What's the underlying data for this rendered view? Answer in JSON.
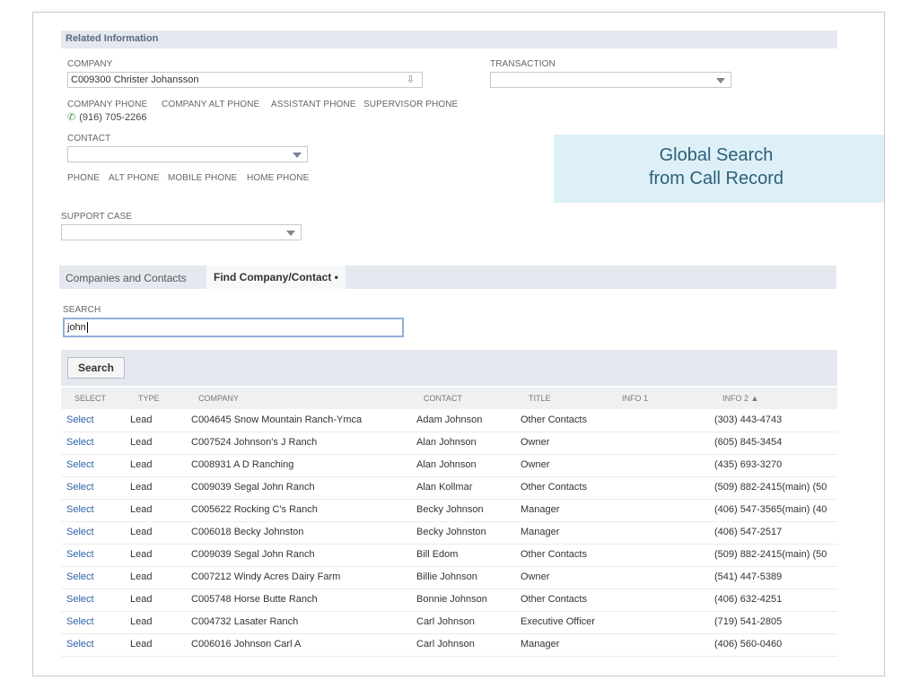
{
  "section_title": "Related Information",
  "company": {
    "label": "COMPANY",
    "value": "C009300 Christer Johansson"
  },
  "transaction": {
    "label": "TRANSACTION",
    "value": ""
  },
  "phone_labels": [
    "COMPANY PHONE",
    "COMPANY ALT PHONE",
    "ASSISTANT PHONE",
    "SUPERVISOR PHONE"
  ],
  "company_phone": "(916) 705-2266",
  "contact": {
    "label": "CONTACT",
    "value": ""
  },
  "contact_phone_labels": [
    "PHONE",
    "ALT PHONE",
    "MOBILE PHONE",
    "HOME PHONE"
  ],
  "support_case": {
    "label": "SUPPORT CASE",
    "value": ""
  },
  "callout": {
    "line1": "Global Search",
    "line2": "from Call Record"
  },
  "tabs": {
    "tab1": "Companies and Contacts",
    "tab2": "Find Company/Contact •"
  },
  "search": {
    "label": "SEARCH",
    "value": "john",
    "button": "Search"
  },
  "table": {
    "headers": [
      "SELECT",
      "TYPE",
      "COMPANY",
      "CONTACT",
      "TITLE",
      "INFO 1",
      "INFO 2 ▲"
    ],
    "rows": [
      [
        "Select",
        "Lead",
        "C004645 Snow Mountain Ranch-Ymca",
        "Adam Johnson",
        "Other Contacts",
        "",
        "(303) 443-4743"
      ],
      [
        "Select",
        "Lead",
        "C007524 Johnson's J Ranch",
        "Alan Johnson",
        "Owner",
        "",
        "(605) 845-3454"
      ],
      [
        "Select",
        "Lead",
        "C008931 A D Ranching",
        "Alan Johnson",
        "Owner",
        "",
        "(435) 693-3270"
      ],
      [
        "Select",
        "Lead",
        "C009039 Segal John Ranch",
        "Alan Kollmar",
        "Other Contacts",
        "",
        "(509) 882-2415(main) (50"
      ],
      [
        "Select",
        "Lead",
        "C005622 Rocking C's Ranch",
        "Becky Johnson",
        "Manager",
        "",
        "(406) 547-3565(main) (40"
      ],
      [
        "Select",
        "Lead",
        "C006018 Becky Johnston",
        "Becky Johnston",
        "Manager",
        "",
        "(406) 547-2517"
      ],
      [
        "Select",
        "Lead",
        "C009039 Segal John Ranch",
        "Bill Edom",
        "Other Contacts",
        "",
        "(509) 882-2415(main) (50"
      ],
      [
        "Select",
        "Lead",
        "C007212 Windy Acres Dairy Farm",
        "Billie Johnson",
        "Owner",
        "",
        "(541) 447-5389"
      ],
      [
        "Select",
        "Lead",
        "C005748 Horse Butte Ranch",
        "Bonnie Johnson",
        "Other Contacts",
        "",
        "(406) 632-4251"
      ],
      [
        "Select",
        "Lead",
        "C004732 Lasater Ranch",
        "Carl Johnson",
        "Executive Officer",
        "",
        "(719) 541-2805"
      ],
      [
        "Select",
        "Lead",
        "C006016 Johnson Carl A",
        "Carl Johnson",
        "Manager",
        "",
        "(406) 560-0460"
      ]
    ]
  },
  "colors": {
    "link": "#2d62a8",
    "band": "#e4e8ef",
    "callout_bg": "#def0f7",
    "callout_text": "#2d5f78"
  }
}
